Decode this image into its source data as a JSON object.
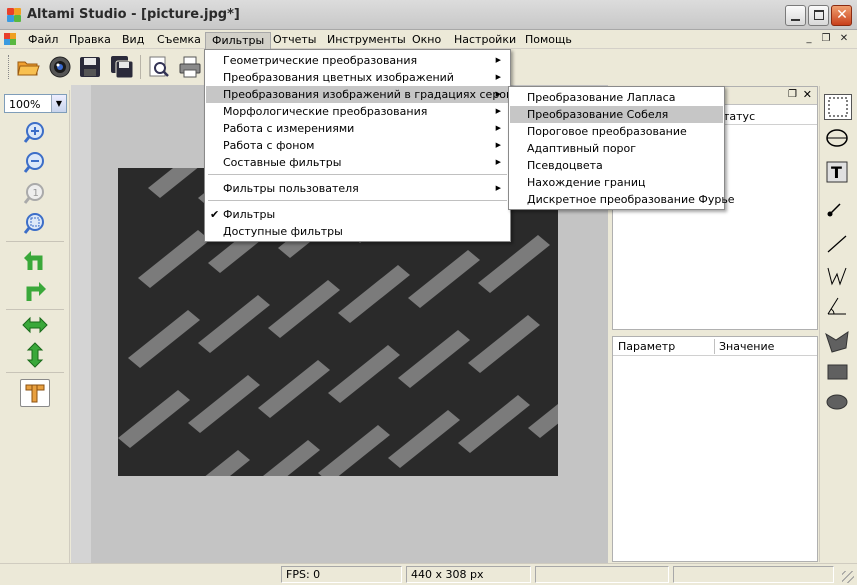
{
  "window": {
    "title": "Altami Studio - [picture.jpg*]"
  },
  "menubar": {
    "items": [
      "Файл",
      "Правка",
      "Вид",
      "Съемка",
      "Фильтры",
      "Отчеты",
      "Инструменты",
      "Окно",
      "Настройки",
      "Помощь"
    ],
    "active": "Фильтры"
  },
  "zoom": {
    "value": "100%"
  },
  "filters_menu": {
    "items": [
      {
        "label": "Геометрические преобразования",
        "submenu": true
      },
      {
        "label": "Преобразования цветных изображений",
        "submenu": true
      },
      {
        "label": "Преобразования изображений в градациях серого",
        "submenu": true,
        "highlighted": true
      },
      {
        "label": "Морфологические преобразования",
        "submenu": true
      },
      {
        "label": "Работа с измерениями",
        "submenu": true
      },
      {
        "label": "Работа с фоном",
        "submenu": true
      },
      {
        "label": "Составные фильтры",
        "submenu": true
      },
      {
        "label": "Фильтры пользователя",
        "submenu": true
      },
      {
        "label": "Фильтры",
        "checked": true
      },
      {
        "label": "Доступные фильтры"
      }
    ]
  },
  "grayscale_submenu": {
    "items": [
      {
        "label": "Преобразование Лапласа"
      },
      {
        "label": "Преобразование Собеля",
        "highlighted": true
      },
      {
        "label": "Пороговое преобразование"
      },
      {
        "label": "Адаптивный порог"
      },
      {
        "label": "Псевдоцвета"
      },
      {
        "label": "Нахождение границ"
      },
      {
        "label": "Дискретное преобразование Фурье"
      }
    ]
  },
  "top_panel": {
    "column_fragment": "татус"
  },
  "params_panel": {
    "col_param": "Параметр",
    "col_value": "Значение"
  },
  "status": {
    "fps": "FPS: 0",
    "size": "440 x 308 px"
  },
  "colors": {
    "menu_highlight": "#c6c6c6",
    "canvas_bg": "#c4c4c4",
    "accent_blue": "#3c6ec8",
    "green_arrow": "#3aa83a"
  }
}
